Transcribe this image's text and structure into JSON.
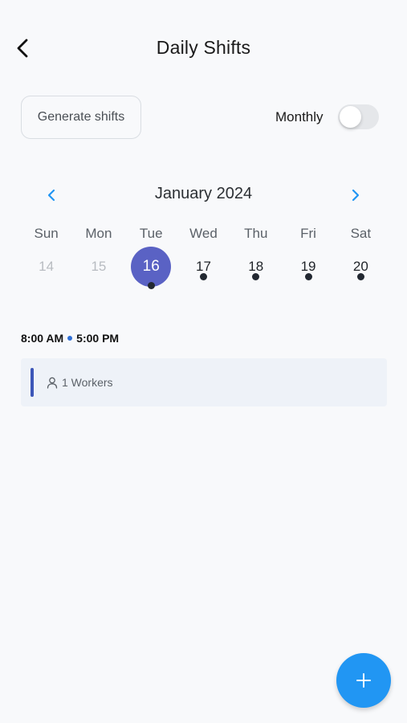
{
  "header": {
    "title": "Daily Shifts",
    "back_icon": "chevron-left-icon"
  },
  "controls": {
    "generate_label": "Generate shifts",
    "monthly_label": "Monthly",
    "monthly_toggle_on": false
  },
  "calendar": {
    "month_title": "January 2024",
    "prev_icon": "chevron-left-icon",
    "next_icon": "chevron-right-icon",
    "days": [
      {
        "name": "Sun",
        "num": "14",
        "muted": true,
        "has_dot": false,
        "selected": false
      },
      {
        "name": "Mon",
        "num": "15",
        "muted": true,
        "has_dot": false,
        "selected": false
      },
      {
        "name": "Tue",
        "num": "16",
        "muted": false,
        "has_dot": true,
        "selected": true
      },
      {
        "name": "Wed",
        "num": "17",
        "muted": false,
        "has_dot": true,
        "selected": false
      },
      {
        "name": "Thu",
        "num": "18",
        "muted": false,
        "has_dot": true,
        "selected": false
      },
      {
        "name": "Fri",
        "num": "19",
        "muted": false,
        "has_dot": true,
        "selected": false
      },
      {
        "name": "Sat",
        "num": "20",
        "muted": false,
        "has_dot": true,
        "selected": false
      }
    ]
  },
  "shift": {
    "start": "8:00 AM",
    "end": "5:00 PM",
    "workers": "1 Workers",
    "workers_icon": "person-icon"
  },
  "fab": {
    "icon": "plus-icon"
  },
  "colors": {
    "accent": "#5a62c4",
    "fab": "#2196f3",
    "nav_arrow": "#2196f3",
    "shift_bar": "#3c56b8"
  }
}
